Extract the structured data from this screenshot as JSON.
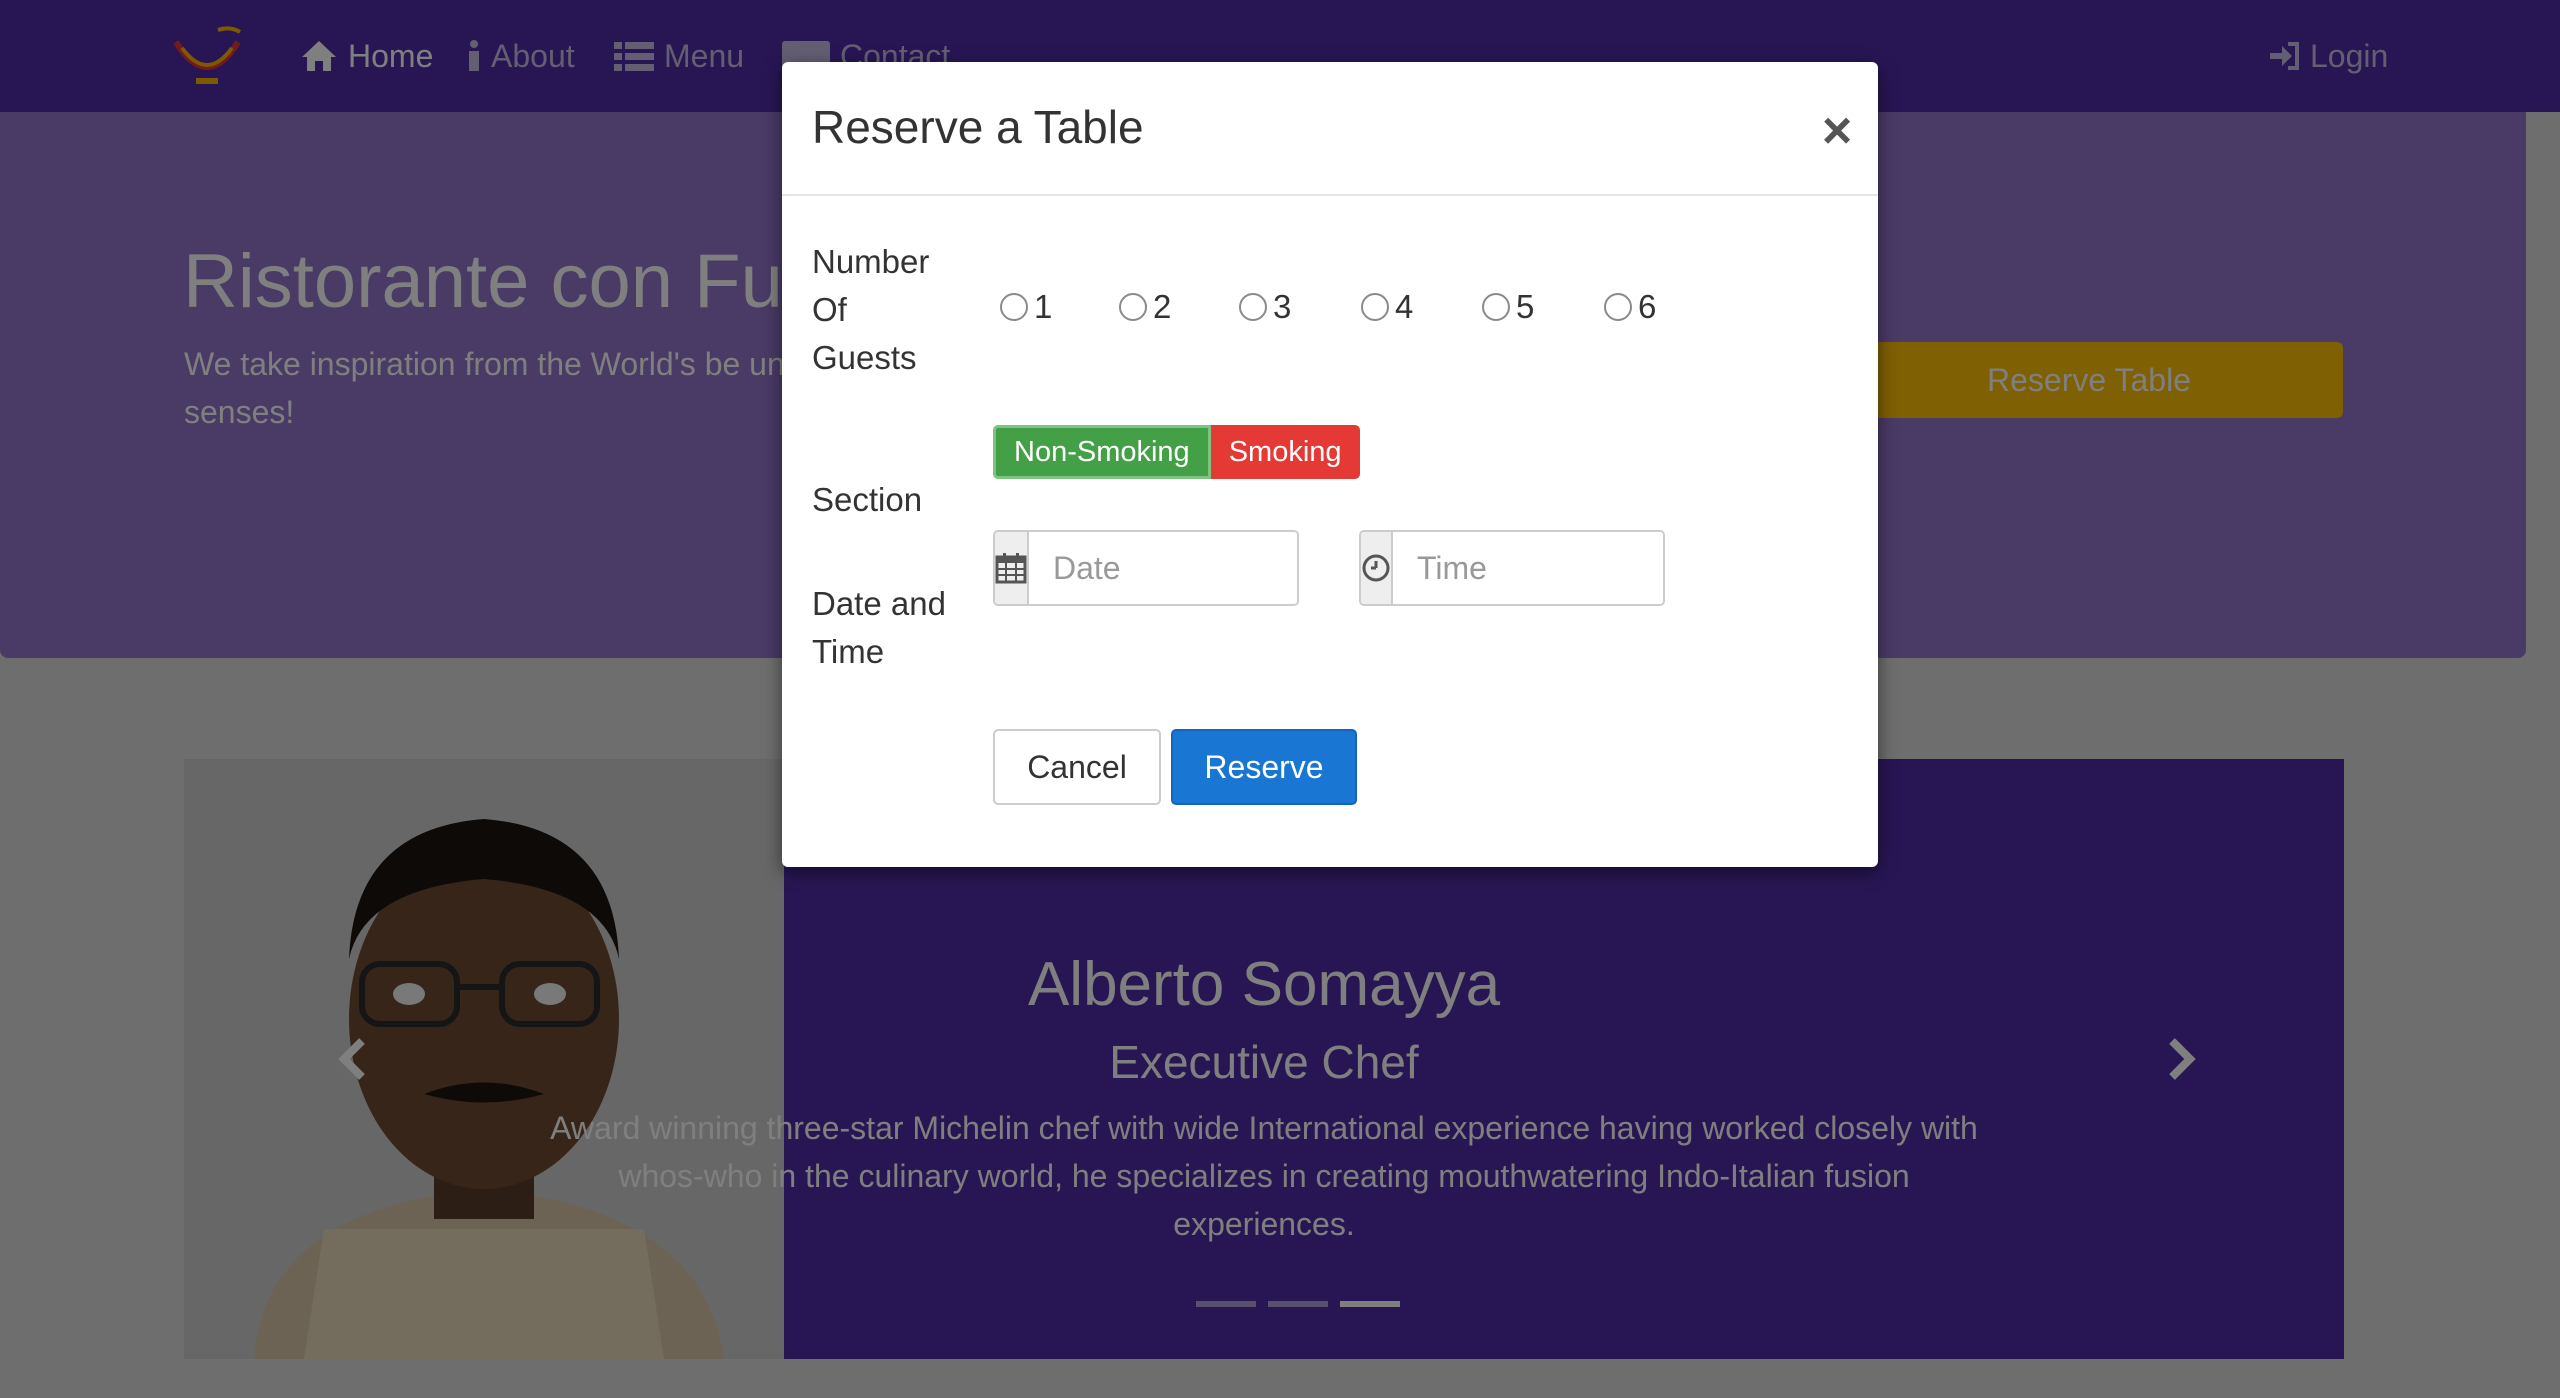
{
  "navbar": {
    "items": [
      {
        "label": "Home",
        "icon": "home-icon"
      },
      {
        "label": "About",
        "icon": "info-icon"
      },
      {
        "label": "Menu",
        "icon": "list-icon"
      },
      {
        "label": "Contact",
        "icon": "address-card-icon"
      }
    ],
    "login_label": "Login",
    "color": "#512DA8"
  },
  "jumbotron": {
    "title": "Ristorante con Fu",
    "text": "We take inspiration from the World's be unique fusion experience. Our lipsmacki culinary senses!",
    "reserve_button": "Reserve Table"
  },
  "carousel": {
    "name": "Alberto Somayya",
    "designation": "Executive Chef",
    "description": "Award winning three-star Michelin chef with wide International experience having worked closely with whos-who in the culinary world, he specializes in creating mouthwatering Indo-Italian fusion experiences.",
    "active_index": 2
  },
  "modal": {
    "title": "Reserve a Table",
    "close_glyph": "×",
    "guests_label": "Number Of Guests",
    "guest_options": [
      "1",
      "2",
      "3",
      "4",
      "5",
      "6"
    ],
    "section_label": "Section",
    "section_options": [
      "Non-Smoking",
      "Smoking"
    ],
    "datetime_label": "Date and Time",
    "date_placeholder": "Date",
    "time_placeholder": "Time",
    "cancel_label": "Cancel",
    "reserve_label": "Reserve"
  }
}
